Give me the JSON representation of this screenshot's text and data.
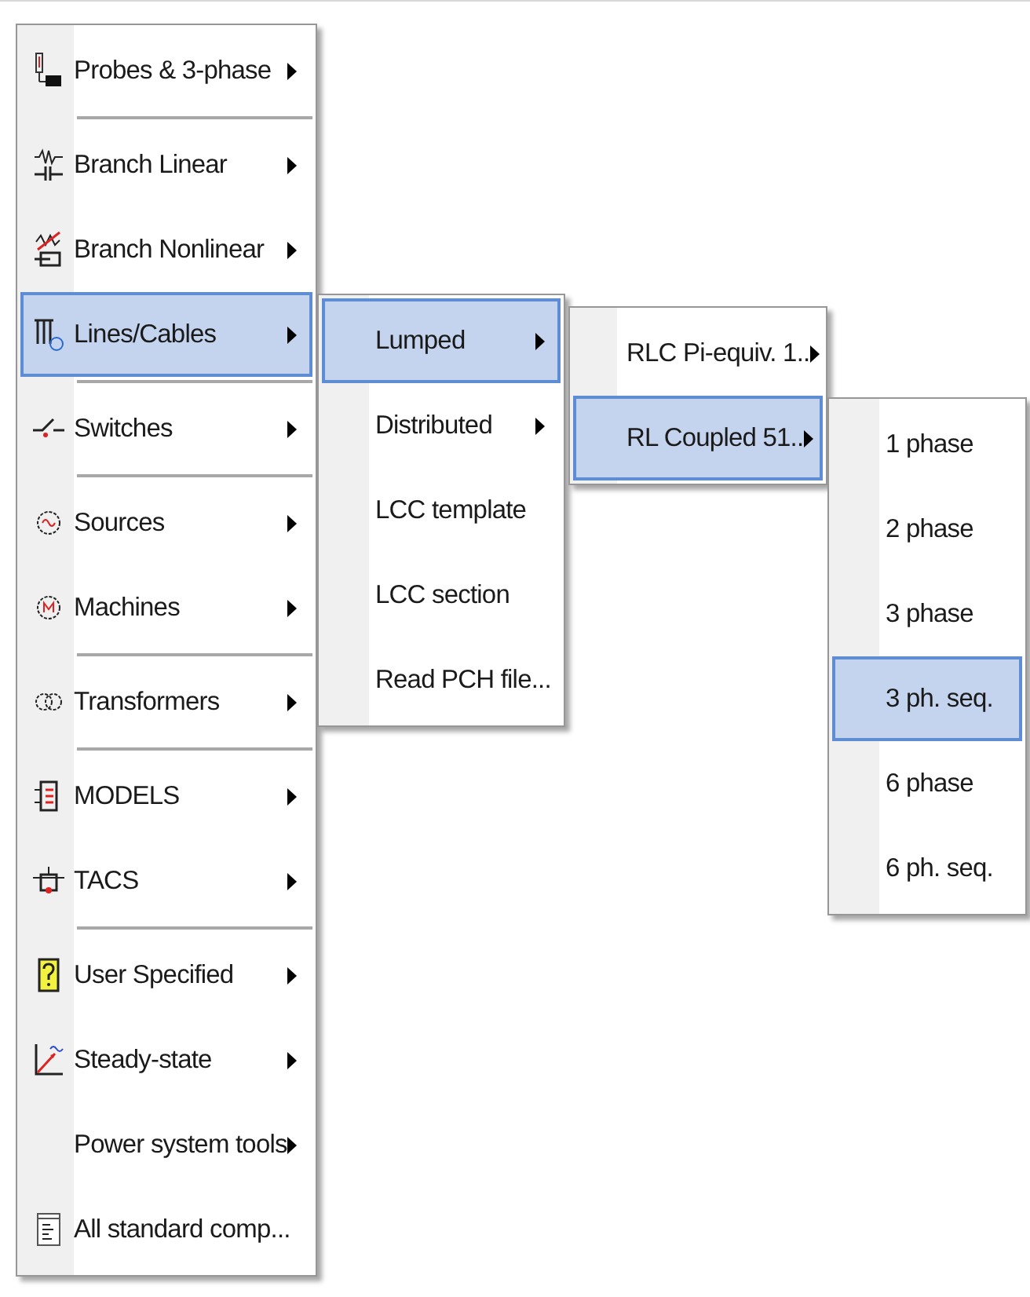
{
  "menus": [
    {
      "items": [
        {
          "kind": "submenu",
          "label": "Probes & 3-phase",
          "selected": false
        },
        {
          "kind": "separator"
        },
        {
          "kind": "submenu",
          "label": "Branch Linear",
          "selected": false
        },
        {
          "kind": "submenu",
          "label": "Branch Nonlinear",
          "selected": false
        },
        {
          "kind": "submenu",
          "label": "Lines/Cables",
          "selected": true
        },
        {
          "kind": "separator"
        },
        {
          "kind": "submenu",
          "label": "Switches",
          "selected": false
        },
        {
          "kind": "separator"
        },
        {
          "kind": "submenu",
          "label": "Sources",
          "selected": false
        },
        {
          "kind": "submenu",
          "label": "Machines",
          "selected": false
        },
        {
          "kind": "separator"
        },
        {
          "kind": "submenu",
          "label": "Transformers",
          "selected": false
        },
        {
          "kind": "separator"
        },
        {
          "kind": "submenu",
          "label": "MODELS",
          "selected": false
        },
        {
          "kind": "submenu",
          "label": "TACS",
          "selected": false
        },
        {
          "kind": "separator"
        },
        {
          "kind": "submenu",
          "label": "User Specified",
          "selected": false
        },
        {
          "kind": "submenu",
          "label": "Steady-state",
          "selected": false
        },
        {
          "kind": "submenu",
          "label": "Power system tools",
          "selected": false
        },
        {
          "kind": "command",
          "label": "All standard comp...",
          "selected": false
        }
      ]
    },
    {
      "items": [
        {
          "kind": "submenu",
          "label": "Lumped",
          "selected": true
        },
        {
          "kind": "submenu",
          "label": "Distributed",
          "selected": false
        },
        {
          "kind": "command",
          "label": "LCC template",
          "selected": false
        },
        {
          "kind": "command",
          "label": "LCC section",
          "selected": false
        },
        {
          "kind": "command",
          "label": "Read PCH file...",
          "selected": false
        }
      ]
    },
    {
      "items": [
        {
          "kind": "submenu",
          "label": "RLC Pi-equiv. 1..",
          "selected": false
        },
        {
          "kind": "submenu",
          "label": "RL Coupled 51..",
          "selected": true
        }
      ]
    },
    {
      "items": [
        {
          "kind": "command",
          "label": "1 phase",
          "selected": false
        },
        {
          "kind": "command",
          "label": "2 phase",
          "selected": false
        },
        {
          "kind": "command",
          "label": "3 phase",
          "selected": false
        },
        {
          "kind": "command",
          "label": "3 ph. seq.",
          "selected": true
        },
        {
          "kind": "command",
          "label": "6 phase",
          "selected": false
        },
        {
          "kind": "command",
          "label": "6 ph. seq.",
          "selected": false
        }
      ]
    }
  ]
}
